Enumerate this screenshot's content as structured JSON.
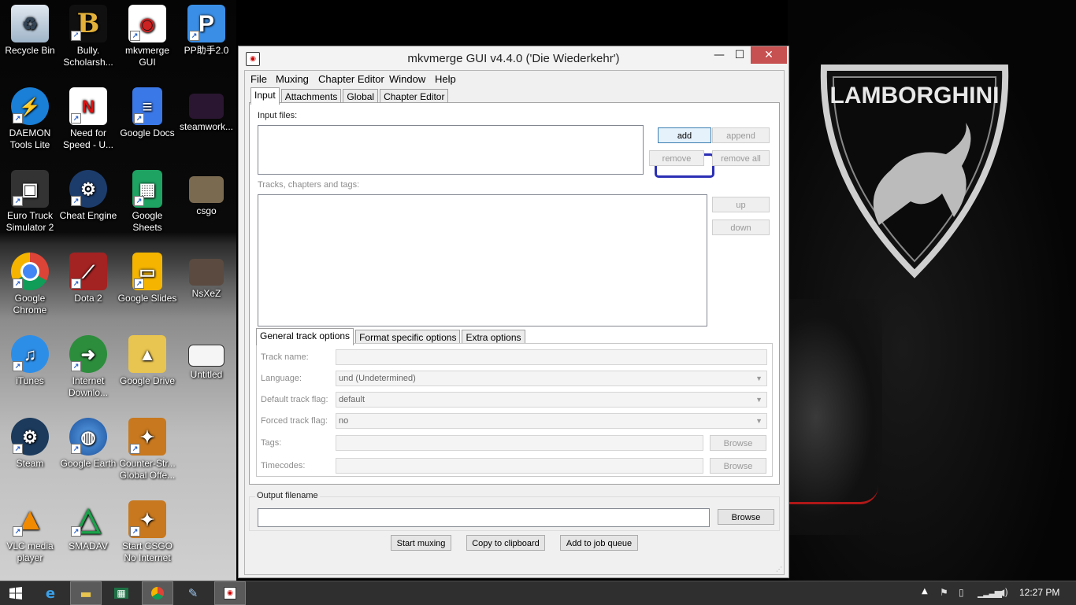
{
  "desktop": {
    "icons": [
      {
        "label": "Recycle Bin"
      },
      {
        "label": "Bully. Scholarsh..."
      },
      {
        "label": "mkvmerge GUI"
      },
      {
        "label": "PP助手2.0"
      },
      {
        "label": "DAEMON Tools Lite"
      },
      {
        "label": "Need for Speed - U..."
      },
      {
        "label": "Google Docs"
      },
      {
        "label": "steamwork..."
      },
      {
        "label": "Euro Truck Simulator 2"
      },
      {
        "label": "Cheat Engine"
      },
      {
        "label": "Google Sheets"
      },
      {
        "label": "csgo"
      },
      {
        "label": "Google Chrome"
      },
      {
        "label": "Dota 2"
      },
      {
        "label": "Google Slides"
      },
      {
        "label": "NsXeZ"
      },
      {
        "label": "iTunes"
      },
      {
        "label": "Internet Downlo..."
      },
      {
        "label": "Google Drive"
      },
      {
        "label": "Untitled"
      },
      {
        "label": "Steam"
      },
      {
        "label": "Google Earth"
      },
      {
        "label": "Counter-Str... Global Offe..."
      },
      {
        "label": "VLC media player"
      },
      {
        "label": "SMADAV"
      },
      {
        "label": "Start CSGO No Internet"
      }
    ],
    "wallpaper_text": "LAMBORGHINI"
  },
  "window": {
    "title": "mkvmerge GUI v4.4.0 ('Die Wiederkehr')",
    "controls": {
      "minimize": "—",
      "maximize": "☐",
      "close": "✕"
    },
    "menu": [
      "File",
      "Muxing",
      "Chapter Editor",
      "Window",
      "Help"
    ],
    "tabs": [
      "Input",
      "Attachments",
      "Global",
      "Chapter Editor"
    ],
    "input": {
      "input_files_label": "Input files:",
      "buttons": {
        "add": "add",
        "append": "append",
        "remove": "remove",
        "remove_all": "remove all"
      },
      "tracks_label": "Tracks, chapters and tags:",
      "track_buttons": {
        "up": "up",
        "down": "down"
      }
    },
    "subtabs": [
      "General track options",
      "Format specific options",
      "Extra options"
    ],
    "general": {
      "track_name_label": "Track name:",
      "track_name_value": "",
      "language_label": "Language:",
      "language_value": "und (Undetermined)",
      "default_flag_label": "Default track flag:",
      "default_flag_value": "default",
      "forced_flag_label": "Forced track flag:",
      "forced_flag_value": "no",
      "tags_label": "Tags:",
      "tags_value": "",
      "tags_browse": "Browse",
      "timecodes_label": "Timecodes:",
      "timecodes_value": "",
      "timecodes_browse": "Browse"
    },
    "output": {
      "group_label": "Output filename",
      "value": "",
      "browse": "Browse"
    },
    "actions": {
      "start": "Start muxing",
      "copy": "Copy to clipboard",
      "queue": "Add to job queue"
    }
  },
  "taskbar": {
    "apps": [
      "windows-start",
      "internet-explorer",
      "file-explorer",
      "excel",
      "chrome",
      "paint",
      "mkvmerge"
    ],
    "clock": "12:27 PM"
  },
  "colors": {
    "highlight": "#2b2fb5",
    "close_button": "#c75050",
    "taskbar": "#2f2f2f"
  }
}
